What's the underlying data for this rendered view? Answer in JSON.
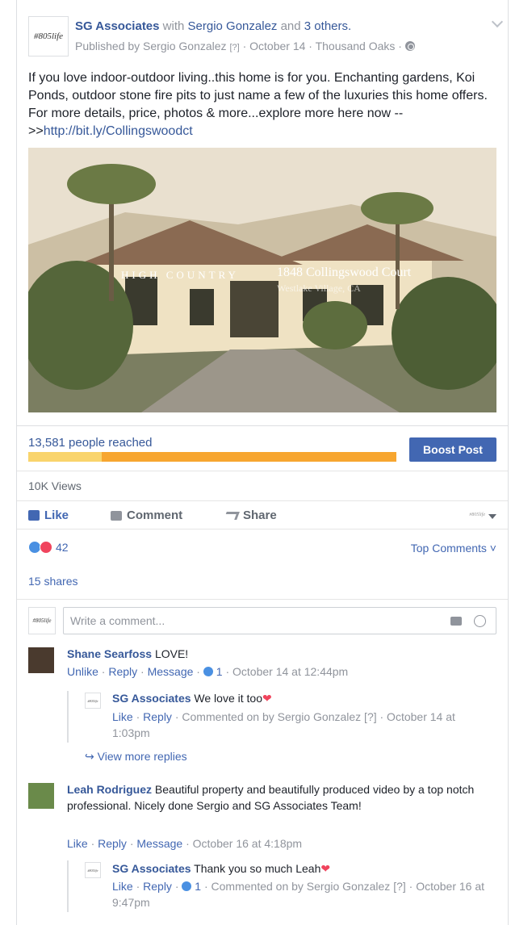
{
  "post": {
    "page_logo_text": "#805life",
    "author": "SG Associates",
    "with_word": " with ",
    "tagged": "Sergio Gonzalez",
    "and_word": " and ",
    "others": "3 others.",
    "published_prefix": "Published by Sergio Gonzalez",
    "published_q": "[?]",
    "published_rest": " · October 14 · Thousand Oaks · ",
    "text": "If you love indoor-outdoor living..this home is for you. Enchanting gardens, Koi Ponds, outdoor stone fire pits to just name a few of the luxuries this home offers. For more details, price, photos & more...explore more here now -->>",
    "link": "http://bit.ly/Collingswoodct",
    "photo": {
      "brand": "HIGH COUNTRY",
      "address": "1848 Collingswood Court",
      "city": "Westlake Village, CA"
    }
  },
  "stats": {
    "reach": "13,581 people reached",
    "reach_fraction": 0.2,
    "boost_label": "Boost Post",
    "views": "10K Views"
  },
  "actions": {
    "like": "Like",
    "comment": "Comment",
    "share": "Share"
  },
  "reactions": {
    "count": "42",
    "top_comments": "Top Comments"
  },
  "shares": "15 shares",
  "composer": {
    "avatar_text": "#805life",
    "placeholder": "Write a comment..."
  },
  "comments": [
    {
      "name": "Shane Searfoss",
      "text": " LOVE!",
      "unlike": "Unlike",
      "reply": "Reply",
      "message": "Message",
      "likes": "1",
      "time": "October 14 at 12:44pm"
    },
    {
      "name": "SG Associates",
      "text": " We love it too",
      "like": "Like",
      "reply": "Reply",
      "meta_rest": " · Commented on by Sergio Gonzalez [?] · October 14 at 1:03pm"
    },
    {
      "view_more": "View more replies"
    },
    {
      "name": "Leah Rodriguez",
      "text": " Beautiful property and beautifully produced video by a top notch professional. Nicely done Sergio and SG Associates Team!",
      "like": "Like",
      "reply": "Reply",
      "message": "Message",
      "time": "October 16 at 4:18pm"
    },
    {
      "name": "SG Associates",
      "text": " Thank you so much Leah",
      "like": "Like",
      "reply": "Reply",
      "likes": "1",
      "meta_rest": " · Commented on by Sergio Gonzalez [?] · October 16 at 9:47pm"
    }
  ]
}
